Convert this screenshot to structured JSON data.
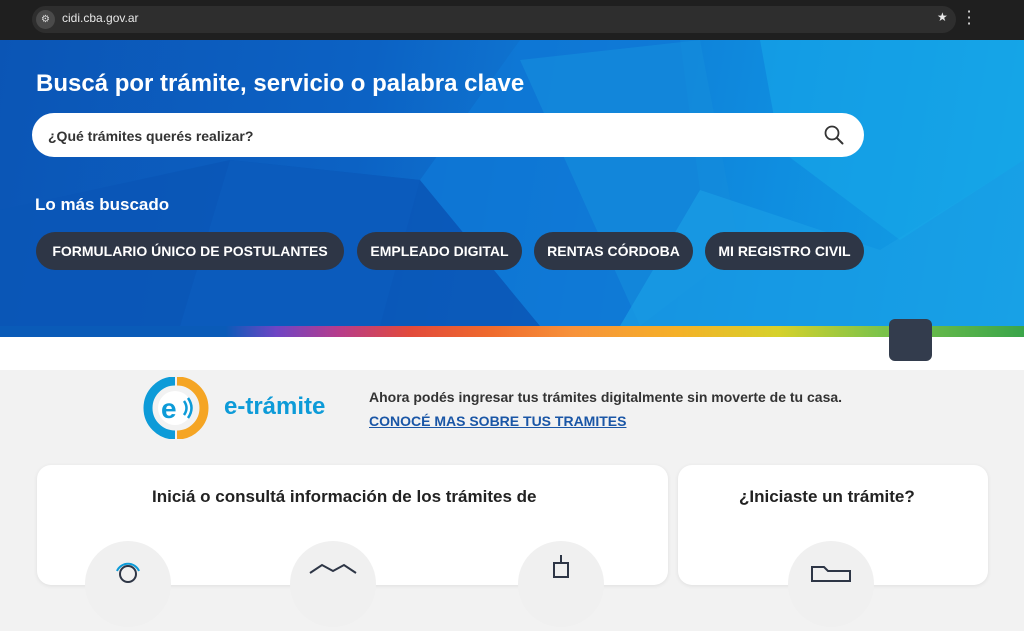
{
  "browser": {
    "url": "cidi.cba.gov.ar",
    "site_icon": "tune-icon",
    "bookmark_icon": "star-icon",
    "menu_icon": "kebab-menu-icon"
  },
  "hero": {
    "title": "Buscá por trámite, servicio o palabra clave",
    "search_placeholder": "¿Qué trámites querés realizar?",
    "popular_title": "Lo más buscado",
    "chips": [
      "FORMULARIO ÚNICO DE POSTULANTES",
      "EMPLEADO DIGITAL",
      "RENTAS CÓRDOBA",
      "MI REGISTRO CIVIL"
    ]
  },
  "etramite": {
    "logo_text": "e-trámite",
    "promo": "Ahora podés ingresar tus trámites digitalmente sin moverte de tu casa.",
    "link": "CONOCÉ MAS SOBRE TUS TRAMITES"
  },
  "cards": {
    "left_title": "Iniciá o consultá información de los trámites de",
    "right_title": "¿Iniciaste un trámite?"
  },
  "colors": {
    "hero_blue": "#0c62c4",
    "chip_bg": "#2e3646",
    "link_blue": "#1a56a6",
    "logo_blue": "#0d9bd8",
    "logo_orange": "#f5a524"
  }
}
